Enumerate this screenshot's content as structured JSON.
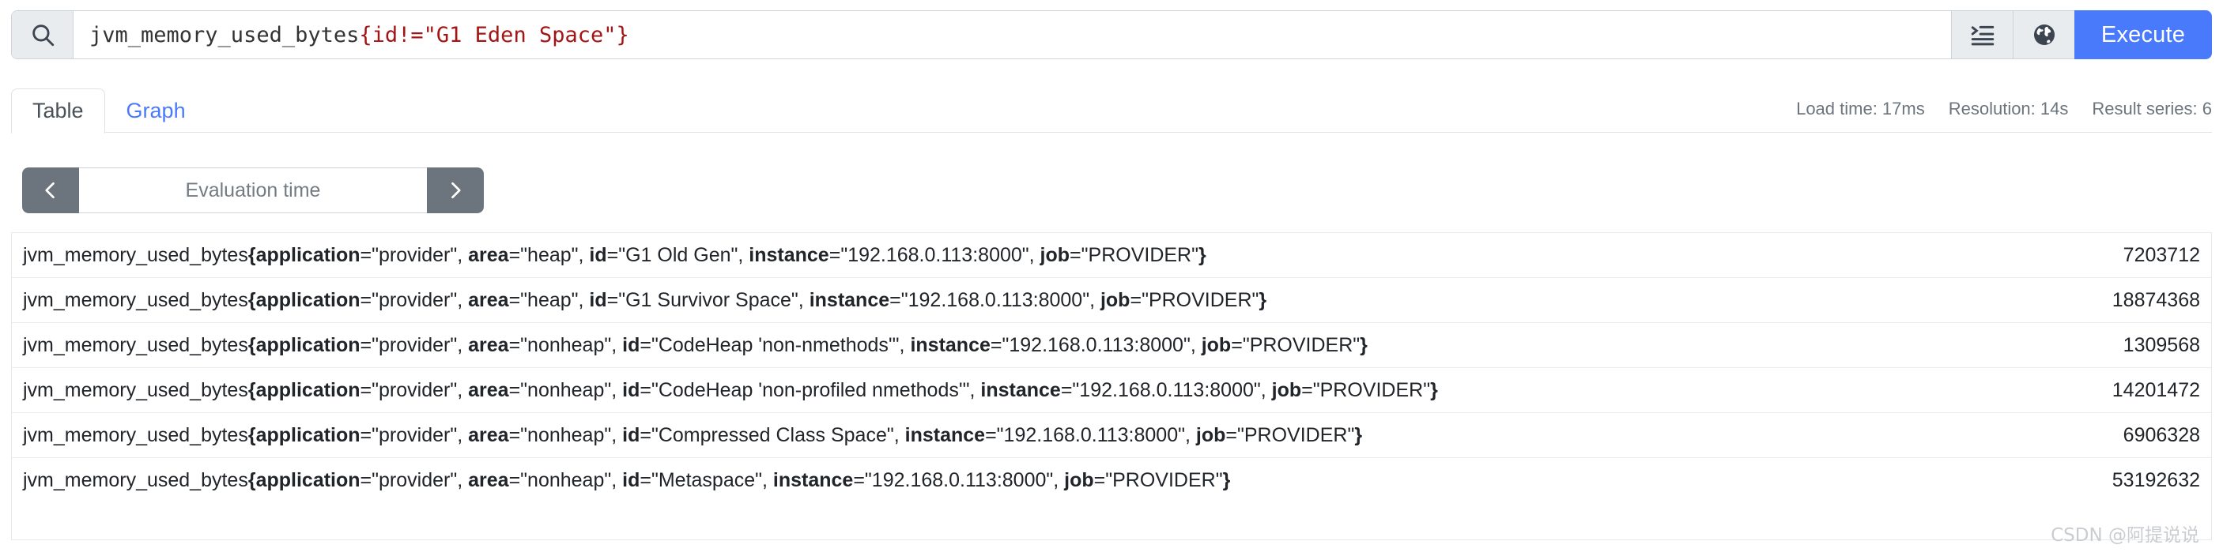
{
  "query_bar": {
    "search_icon": "search-icon",
    "expression": "jvm_memory_used_bytes{id!=\"G1 Eden Space\"}",
    "expression_metric": "jvm_memory_used_bytes",
    "expression_matcher": "{id!=\"G1 Eden Space\"}",
    "metrics_explorer_icon": "metrics-explorer-icon",
    "globe_icon": "globe-icon",
    "execute_label": "Execute"
  },
  "tabs": [
    {
      "label": "Table",
      "active": true
    },
    {
      "label": "Graph",
      "active": false
    }
  ],
  "meta": {
    "load_time": "Load time: 17ms",
    "resolution": "Resolution: 14s",
    "result_series": "Result series: 6"
  },
  "eval_time": {
    "prev_icon": "chevron-left-icon",
    "next_icon": "chevron-right-icon",
    "placeholder": "Evaluation time",
    "value": ""
  },
  "table": {
    "rows": [
      {
        "metric": "jvm_memory_used_bytes",
        "labels": [
          {
            "name": "application",
            "value": "\"provider\""
          },
          {
            "name": "area",
            "value": "\"heap\""
          },
          {
            "name": "id",
            "value": "\"G1 Old Gen\""
          },
          {
            "name": "instance",
            "value": "\"192.168.0.113:8000\""
          },
          {
            "name": "job",
            "value": "\"PROVIDER\""
          }
        ],
        "value": "7203712"
      },
      {
        "metric": "jvm_memory_used_bytes",
        "labels": [
          {
            "name": "application",
            "value": "\"provider\""
          },
          {
            "name": "area",
            "value": "\"heap\""
          },
          {
            "name": "id",
            "value": "\"G1 Survivor Space\""
          },
          {
            "name": "instance",
            "value": "\"192.168.0.113:8000\""
          },
          {
            "name": "job",
            "value": "\"PROVIDER\""
          }
        ],
        "value": "18874368"
      },
      {
        "metric": "jvm_memory_used_bytes",
        "labels": [
          {
            "name": "application",
            "value": "\"provider\""
          },
          {
            "name": "area",
            "value": "\"nonheap\""
          },
          {
            "name": "id",
            "value": "\"CodeHeap 'non-nmethods'\""
          },
          {
            "name": "instance",
            "value": "\"192.168.0.113:8000\""
          },
          {
            "name": "job",
            "value": "\"PROVIDER\""
          }
        ],
        "value": "1309568"
      },
      {
        "metric": "jvm_memory_used_bytes",
        "labels": [
          {
            "name": "application",
            "value": "\"provider\""
          },
          {
            "name": "area",
            "value": "\"nonheap\""
          },
          {
            "name": "id",
            "value": "\"CodeHeap 'non-profiled nmethods'\""
          },
          {
            "name": "instance",
            "value": "\"192.168.0.113:8000\""
          },
          {
            "name": "job",
            "value": "\"PROVIDER\""
          }
        ],
        "value": "14201472"
      },
      {
        "metric": "jvm_memory_used_bytes",
        "labels": [
          {
            "name": "application",
            "value": "\"provider\""
          },
          {
            "name": "area",
            "value": "\"nonheap\""
          },
          {
            "name": "id",
            "value": "\"Compressed Class Space\""
          },
          {
            "name": "instance",
            "value": "\"192.168.0.113:8000\""
          },
          {
            "name": "job",
            "value": "\"PROVIDER\""
          }
        ],
        "value": "6906328"
      },
      {
        "metric": "jvm_memory_used_bytes",
        "labels": [
          {
            "name": "application",
            "value": "\"provider\""
          },
          {
            "name": "area",
            "value": "\"nonheap\""
          },
          {
            "name": "id",
            "value": "\"Metaspace\""
          },
          {
            "name": "instance",
            "value": "\"192.168.0.113:8000\""
          },
          {
            "name": "job",
            "value": "\"PROVIDER\""
          }
        ],
        "value": "53192632"
      }
    ]
  },
  "watermark": "CSDN @阿提说说",
  "colors": {
    "accent": "#4a7afc",
    "addon_bg": "#e9ecef",
    "border": "#ced4da",
    "muted_text": "#6c757d",
    "matcher_red": "#a31515",
    "eval_btn_bg": "#6c757d"
  }
}
